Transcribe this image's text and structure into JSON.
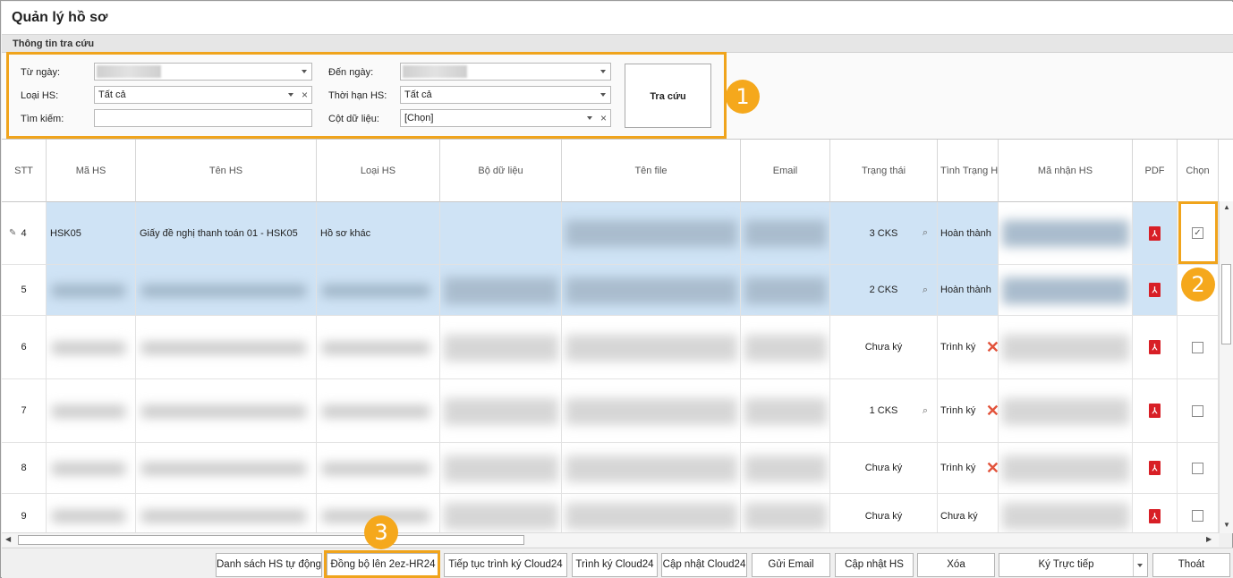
{
  "window": {
    "title": "Quản lý hồ sơ"
  },
  "filter": {
    "group_title": "Thông tin tra cứu",
    "from_label": "Từ ngày:",
    "to_label": "Đến ngày:",
    "type_label": "Loại HS:",
    "type_value": "Tất cả",
    "term_label": "Thời hạn HS:",
    "term_value": "Tất cả",
    "search_label": "Tìm kiếm:",
    "search_value": "",
    "column_label": "Cột dữ liệu:",
    "column_value": "[Chọn]",
    "search_button": "Tra cứu"
  },
  "badges": [
    "1",
    "2",
    "3"
  ],
  "grid": {
    "columns": [
      "STT",
      "Mã HS",
      "Tên HS",
      "Loại HS",
      "Bộ dữ liệu",
      "Tên file",
      "Email",
      "Trạng thái",
      "Tình Trạng HS",
      "Mã nhận HS",
      "PDF",
      "Chọn"
    ],
    "rows": [
      {
        "stt": "4",
        "code": "HSK05",
        "name": "Giấy đề nghị thanh toán 01 - HSK05",
        "type": "Hồ sơ khác",
        "status": "3 CKS",
        "state": "Hoàn thành",
        "checked": true
      },
      {
        "stt": "5",
        "code": "",
        "name": "",
        "type": "",
        "status": "2 CKS",
        "state": "Hoàn thành",
        "checked": false
      },
      {
        "stt": "6",
        "code": "",
        "name": "",
        "type": "",
        "status": "Chưa ký",
        "state": "Trình ký",
        "checked": false
      },
      {
        "stt": "7",
        "code": "",
        "name": "",
        "type": "",
        "status": "1 CKS",
        "state": "Trình ký",
        "checked": false
      },
      {
        "stt": "8",
        "code": "",
        "name": "",
        "type": "",
        "status": "Chưa ký",
        "state": "Trình ký",
        "checked": false
      },
      {
        "stt": "9",
        "code": "",
        "name": "",
        "type": "",
        "status": "Chưa ký",
        "state": "Chưa ký",
        "checked": false
      }
    ]
  },
  "toolbar": {
    "auto_list": "Danh sách HS tự động",
    "sync": "Đồng bộ lên 2ez-HR24",
    "continue_cloud": "Tiếp tục trình ký Cloud24",
    "submit_cloud": "Trình ký Cloud24",
    "update_cloud": "Cập nhật Cloud24",
    "send_email": "Gửi Email",
    "update_hs": "Cập nhật HS",
    "delete": "Xóa",
    "sign_direct": "Ký Trực tiếp",
    "exit": "Thoát"
  },
  "colors": {
    "highlight": "#f0a41c",
    "badge": "#f5a81c",
    "selected_row": "#cfe3f5",
    "pdf": "#d81f26"
  },
  "icons": {
    "pdf": "pdf-icon",
    "search": "magnifier-icon",
    "reject": "x-mark-icon",
    "edit": "pencil-icon"
  }
}
